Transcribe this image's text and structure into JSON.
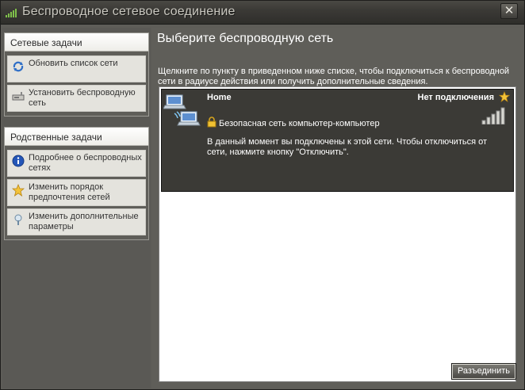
{
  "window": {
    "title": "Беспроводное сетевое соединение",
    "close_label": "✕"
  },
  "sidebar": {
    "network_tasks": {
      "header": "Сетевые задачи",
      "items": [
        {
          "label": "Обновить список сети",
          "icon": "refresh-icon"
        },
        {
          "label": "Установить беспроводную сеть",
          "icon": "setup-network-icon"
        }
      ]
    },
    "related_tasks": {
      "header": "Родственные задачи",
      "items": [
        {
          "label": "Подробнее о беспроводных сетях",
          "icon": "info-icon"
        },
        {
          "label": "Изменить порядок предпочтения  сетей",
          "icon": "star-icon"
        },
        {
          "label": "Изменить дополнительные параметры",
          "icon": "advanced-settings-icon"
        }
      ]
    }
  },
  "main": {
    "title": "Выберите беспроводную сеть",
    "description": "Щелкните по пункту в приведенном ниже списке, чтобы подключиться к беспроводной сети в радиусе действия или получить дополнительные сведения.",
    "networks": [
      {
        "name": "Home",
        "status": "Нет подключения",
        "security": "Безопасная сеть компьютер-компьютер",
        "info": "В данный момент вы подключены к этой сети. Чтобы отключиться от сети, нажмите кнопку \"Отключить\".",
        "signal_bars": 5
      }
    ],
    "disconnect_label": "Разъединить"
  },
  "colors": {
    "accent": "#f0b030",
    "panel_dark": "#3b3a36",
    "panel_mid": "#5f5e59"
  }
}
